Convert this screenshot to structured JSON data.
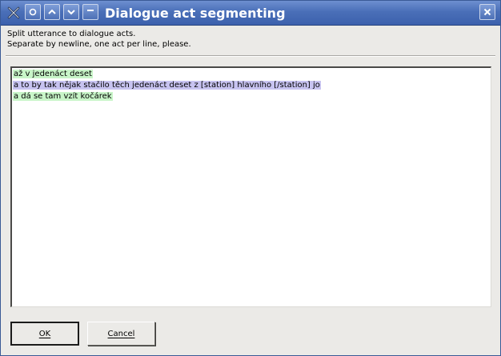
{
  "window": {
    "title": "Dialogue act segmenting"
  },
  "titlebar": {
    "buttons": [
      {
        "icon": "app-menu-icon"
      },
      {
        "icon": "sticky-icon"
      },
      {
        "icon": "chevron-up-icon"
      },
      {
        "icon": "chevron-down-icon"
      },
      {
        "icon": "minimize-icon"
      }
    ],
    "close_icon": "close-icon",
    "colors": {
      "bar": "#4a6fb8",
      "text": "#ffffff"
    }
  },
  "instructions": {
    "line1": "Split utterance to dialogue acts.",
    "line2": "Separate by newline, one act per line, please."
  },
  "editor": {
    "lines": [
      {
        "text": "až v jedenáct deset",
        "highlight": "#c8f5c8"
      },
      {
        "text": "a to by tak nějak stačilo těch jedenáct deset z [station] hlavního [/station] jo",
        "highlight": "#c7c3f0"
      },
      {
        "text": "a dá se tam vzít kočárek",
        "highlight": "#c8f5c8"
      }
    ]
  },
  "buttons": {
    "ok_label": "OK",
    "cancel_label": "Cancel"
  }
}
